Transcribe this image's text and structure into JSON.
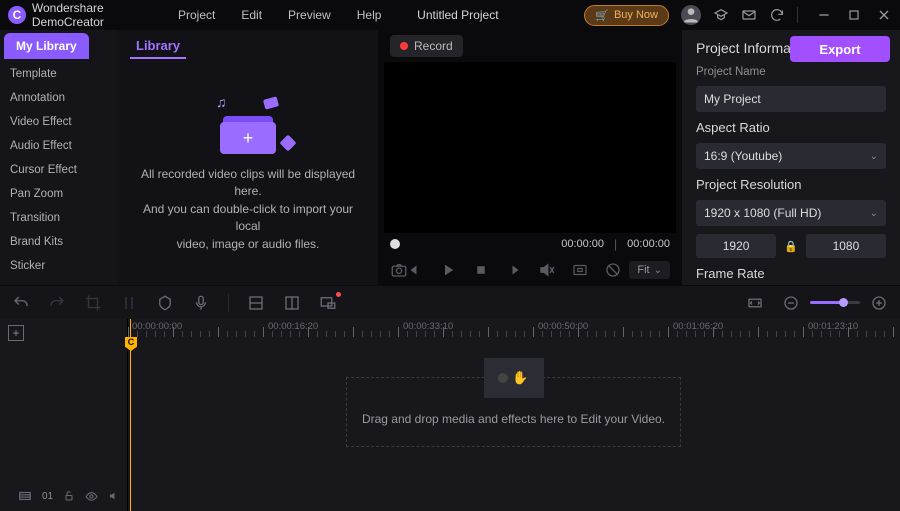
{
  "app": {
    "name": "Wondershare DemoCreator",
    "logo_letter": "C"
  },
  "menu": {
    "project": "Project",
    "edit": "Edit",
    "preview": "Preview",
    "help": "Help"
  },
  "project_title": "Untitled Project",
  "titlebar": {
    "buy": "Buy Now"
  },
  "sidebar": {
    "header": "My Library",
    "items": [
      "Template",
      "Annotation",
      "Video Effect",
      "Audio Effect",
      "Cursor Effect",
      "Pan Zoom",
      "Transition",
      "Brand Kits",
      "Sticker"
    ]
  },
  "library": {
    "tab": "Library",
    "empty_line1": "All recorded video clips will be displayed here.",
    "empty_line2": "And you can double-click to import your local",
    "empty_line3": "video, image or audio files."
  },
  "preview": {
    "record": "Record",
    "time_cur": "00:00:00",
    "time_total": "00:00:00",
    "fit": "Fit"
  },
  "export_label": "Export",
  "project_info": {
    "title": "Project Information",
    "name_label": "Project Name",
    "name_value": "My Project",
    "aspect_label": "Aspect Ratio",
    "aspect_value": "16:9 (Youtube)",
    "res_label": "Project Resolution",
    "res_value": "1920 x 1080 (Full HD)",
    "width": "1920",
    "height": "1080",
    "framerate_label": "Frame Rate"
  },
  "timeline": {
    "labels": [
      "00:00:00:00",
      "00:00:16:20",
      "00:00:33:10",
      "00:00:50:00",
      "00:01:06:20",
      "00:01:23:10"
    ],
    "playhead_mark": "C",
    "track_count": "01",
    "drop_text": "Drag and drop media and effects here to Edit your Video."
  }
}
